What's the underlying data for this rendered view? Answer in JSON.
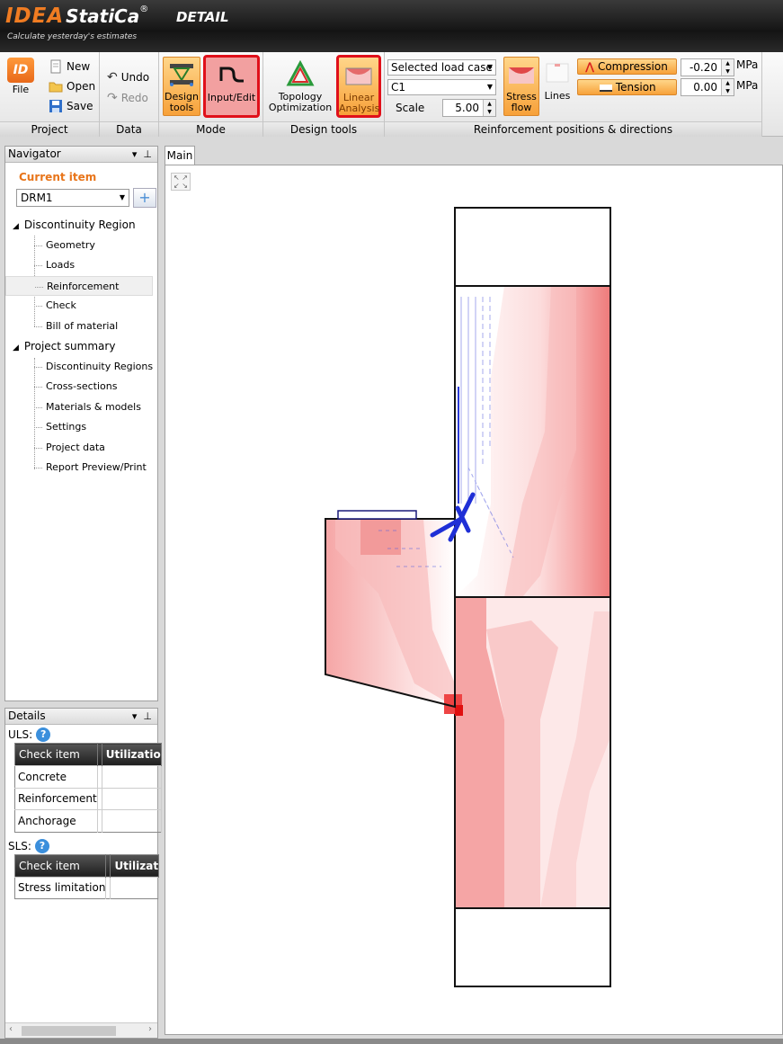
{
  "app": {
    "logo_brand": "IDEA",
    "logo_product": "StatiCa",
    "logo_reg": "®",
    "module": "DETAIL",
    "tagline": "Calculate yesterday's estimates"
  },
  "ribbon": {
    "project": {
      "label": "Project",
      "file": "File",
      "new": "New",
      "open": "Open",
      "save": "Save"
    },
    "data": {
      "label": "Data",
      "undo": "Undo",
      "redo": "Redo"
    },
    "mode": {
      "label": "Mode",
      "design_tools": "Design tools",
      "input_edit": "Input/Edit"
    },
    "design_tools": {
      "label": "Design tools",
      "topology": "Topology Optimization",
      "linear": "Linear Analysis"
    },
    "reinforcement": {
      "label": "Reinforcement positions & directions",
      "load_case_select": "Selected load case",
      "case_select": "C1",
      "scale_label": "Scale",
      "scale_value": "5.00",
      "stress_flow": "Stress flow",
      "lines": "Lines",
      "compression": "Compression",
      "tension": "Tension",
      "compression_value": "-0.20",
      "tension_value": "0.00",
      "unit": "MPa"
    }
  },
  "navigator": {
    "title": "Navigator",
    "current_item": "Current item",
    "selected": "DRM1",
    "tree": {
      "dr": "Discontinuity Region",
      "geometry": "Geometry",
      "loads": "Loads",
      "reinforcement": "Reinforcement",
      "check": "Check",
      "bom": "Bill of material",
      "summary": "Project summary",
      "regions": "Discontinuity Regions",
      "cross": "Cross-sections",
      "materials": "Materials & models",
      "settings": "Settings",
      "project_data": "Project data",
      "report": "Report Preview/Print"
    }
  },
  "details": {
    "title": "Details",
    "uls_label": "ULS:",
    "sls_label": "SLS:",
    "col_check": "Check item",
    "col_util_uls": "Utilizatio",
    "col_util_sls": "Utilizat",
    "uls_rows": [
      "Concrete",
      "Reinforcement",
      "Anchorage"
    ],
    "sls_rows": [
      "Stress limitation"
    ]
  },
  "main_tab": "Main",
  "colors": {
    "accent_orange": "#f07c22",
    "highlight_red": "#e0101a",
    "stress_blue": "#1f2fd6"
  }
}
